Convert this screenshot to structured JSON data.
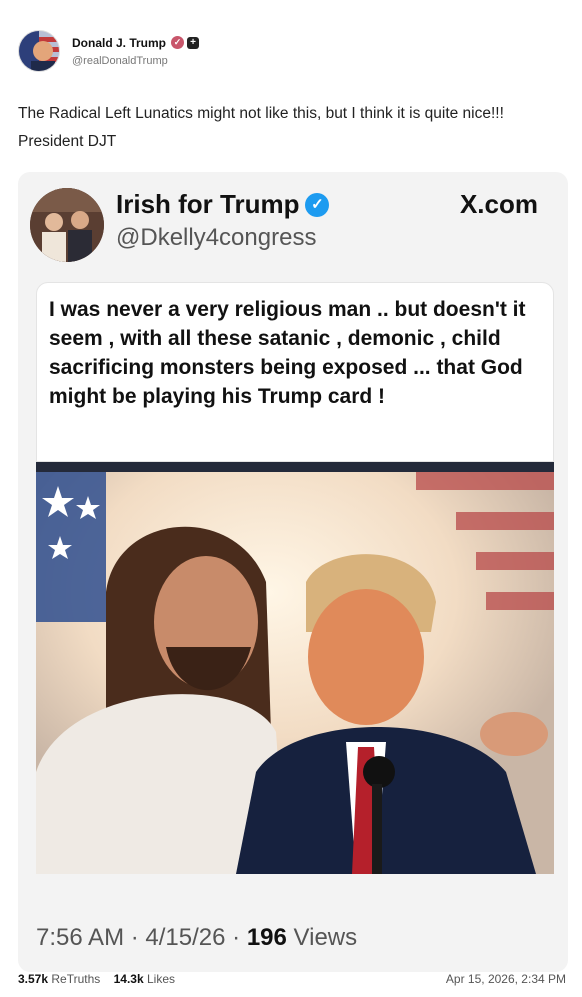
{
  "post": {
    "author_name": "Donald J. Trump",
    "author_handle": "@realDonaldTrump",
    "text": "The Radical Left Lunatics might not like this, but I think it is quite nice!!!  President DJT"
  },
  "embed": {
    "name": "Irish for Trump",
    "handle": "@Dkelly4congress",
    "platform": "X.com",
    "quote": "I was never a very religious man .. but doesn't it seem , with all these satanic , demonic , child sacrificing monsters being exposed ... that God might be playing his Trump card !",
    "time": "7:56 AM",
    "sep": "·",
    "date": "4/15/26",
    "views_count": "196",
    "views_label": "Views"
  },
  "footer": {
    "retruths_count": "3.57k",
    "retruths_label": "ReTruths",
    "likes_count": "14.3k",
    "likes_label": "Likes",
    "timestamp": "Apr 15, 2026, 2:34 PM"
  },
  "icons": {
    "verified_pink": "verified-badge-icon",
    "badge_dark": "plus-badge-icon",
    "verified_blue": "verified-check-icon"
  },
  "colors": {
    "verified_blue": "#1d9bf0",
    "verified_pink": "#c8566b",
    "card_bg": "#f3f3f3"
  }
}
